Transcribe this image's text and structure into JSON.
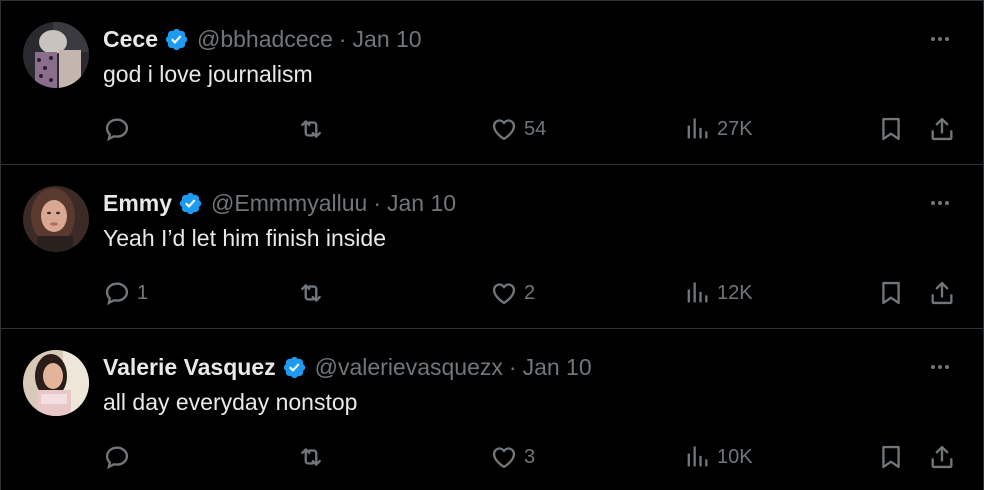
{
  "tweets": [
    {
      "name": "Cece",
      "handle": "@bbhadcece",
      "separator": "·",
      "date": "Jan 10",
      "text": "god i love journalism",
      "replies": "",
      "retweets": "",
      "likes": "54",
      "views": "27K"
    },
    {
      "name": "Emmy",
      "handle": "@Emmmyalluu",
      "separator": "·",
      "date": "Jan 10",
      "text": "Yeah I’d let him finish inside",
      "replies": "1",
      "retweets": "",
      "likes": "2",
      "views": "12K"
    },
    {
      "name": "Valerie Vasquez",
      "handle": "@valerievasquezx",
      "separator": "·",
      "date": "Jan 10",
      "text": "all day everyday nonstop",
      "replies": "",
      "retweets": "",
      "likes": "3",
      "views": "10K"
    }
  ],
  "colors": {
    "background": "#000000",
    "text_primary": "#e7e9ea",
    "text_secondary": "#71767b",
    "verified_badge": "#1d9bf0",
    "divider": "#2f3336"
  },
  "icons": [
    "verified-badge-icon",
    "more-options-icon",
    "reply-icon",
    "retweet-icon",
    "like-icon",
    "views-icon",
    "bookmark-icon",
    "share-icon"
  ]
}
